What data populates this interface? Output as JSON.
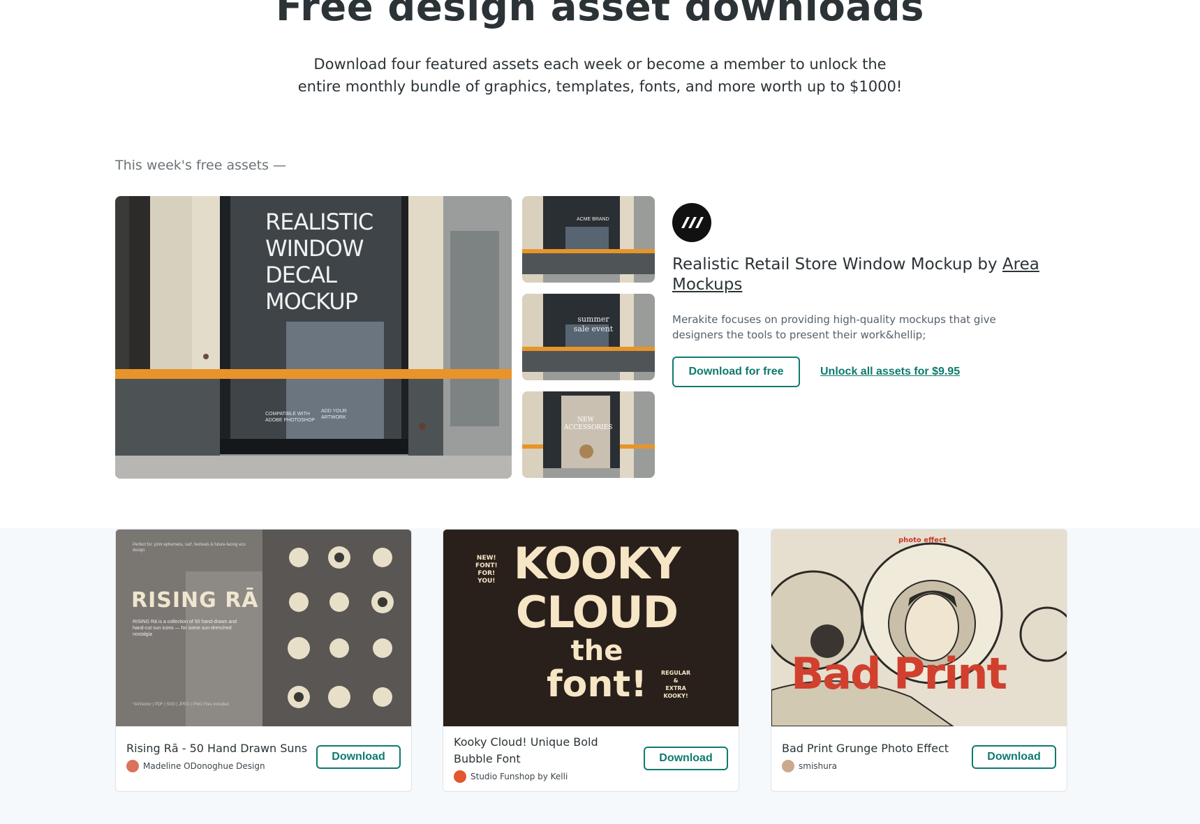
{
  "hero": {
    "title": "Free design asset downloads",
    "subtitle": "Download four featured assets each week or become a member to unlock the entire monthly bundle of graphics, templates, fonts, and more worth up to $1000!"
  },
  "section": {
    "label": "This week's free assets —"
  },
  "featured": {
    "image_text": [
      "REALISTIC",
      "WINDOW",
      "DECAL",
      "MOCKUP"
    ],
    "image_small_text": [
      "COMPATIBLE WITH",
      "ADOBE PHOTOSHOP"
    ],
    "image_small_text2": [
      "ADD YOUR",
      "ARTWORK"
    ],
    "thumb1_text": "ACME BRAND",
    "thumb2_text": "summer sale event",
    "thumb3_text": "NEW ACCESSORIES",
    "title_prefix": "Realistic Retail Store Window Mockup by ",
    "title_author": "Area Mockups",
    "description": "Merakite focuses on providing high-quality mockups that give designers the tools to present their work&hellip;",
    "download_label": "Download for free",
    "unlock_label": "Unlock all assets for $9.95"
  },
  "cards": [
    {
      "title": "Rising Rā - 50 Hand Drawn Suns",
      "author": "Madeline ODonoghue Design",
      "button": "Download",
      "art_heading": "RISING RĀ",
      "art_top": "Perfect for: print ephemera, surf, festivals & future-facing eco design",
      "art_body": "RISING Rā is a collection of 50 hand-drawn and hand-cut sun icons — for some sun-drenched nostalgia",
      "art_footer": "*AI/Vector | PDF | SVG | JPEG | PNG Files included"
    },
    {
      "title": "Kooky Cloud! Unique Bold Bubble Font",
      "author": "Studio Funshop by Kelli",
      "button": "Download",
      "art_side": [
        "NEW!",
        "FONT!",
        "FOR!",
        "YOU!"
      ],
      "art_lines": [
        "KOOKY",
        "CLOUD",
        "the",
        "font!"
      ],
      "art_side2": [
        "REGULAR",
        "&",
        "EXTRA",
        "KOOKY!"
      ]
    },
    {
      "title": "Bad Print Grunge Photo Effect",
      "author": "smishura",
      "button": "Download",
      "art_heading": "Bad Print",
      "art_top": "photo effect"
    }
  ],
  "colors": {
    "accent": "#0e7a6e",
    "text": "#2b3337",
    "band": "#f6f9fb"
  }
}
